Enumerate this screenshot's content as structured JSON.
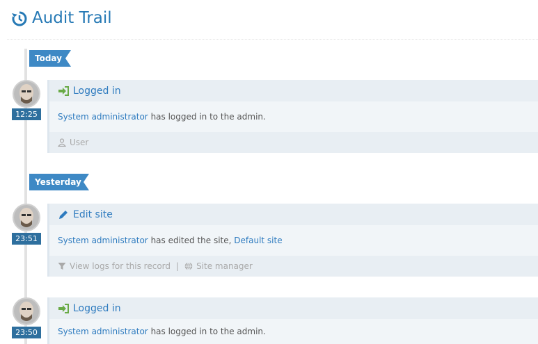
{
  "page": {
    "title": "Audit Trail"
  },
  "days": {
    "today": "Today",
    "yesterday": "Yesterday"
  },
  "entries": [
    {
      "time": "12:25",
      "action": "Logged in",
      "actor": "System administrator",
      "text": "has logged in to the admin.",
      "footer_items": [
        "User"
      ]
    },
    {
      "time": "23:51",
      "action": "Edit site",
      "actor": "System administrator",
      "text": "has edited the site,",
      "target": "Default site",
      "footer_items": [
        "View logs for this record",
        "Site manager"
      ]
    },
    {
      "time": "23:50",
      "action": "Logged in",
      "actor": "System administrator",
      "text": "has logged in to the admin."
    }
  ],
  "colors": {
    "accent": "#2679b5",
    "login_green": "#69aa46",
    "day_label": "#3e89c5"
  }
}
